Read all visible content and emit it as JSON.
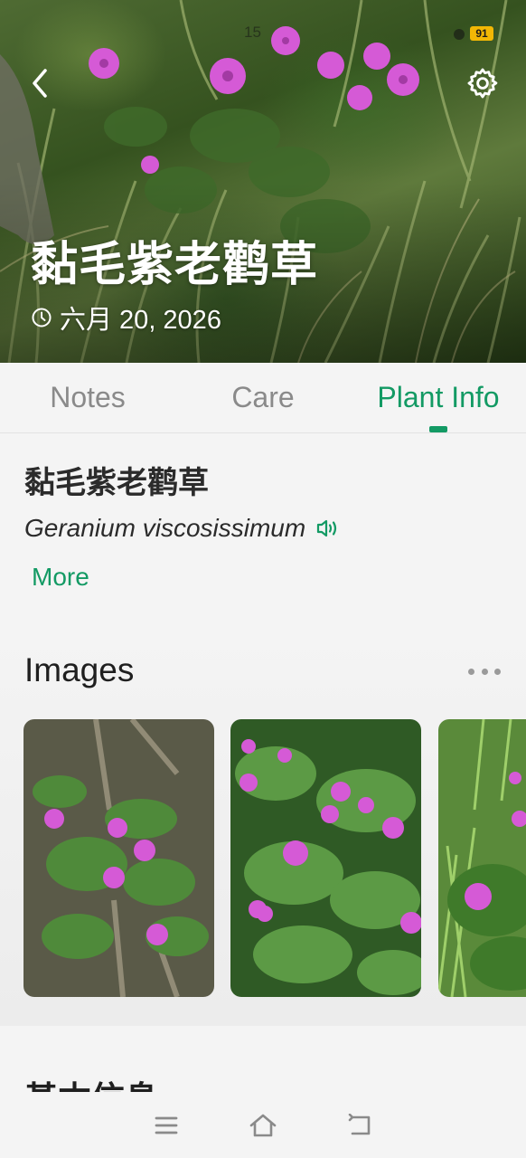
{
  "status_bar": {
    "time": "15",
    "battery": "91"
  },
  "header": {
    "title": "黏毛紫老鹳草",
    "date": "六月 20, 2026",
    "back_icon": "chevron-left-icon",
    "settings_icon": "gear-icon"
  },
  "tabs": [
    {
      "label": "Notes",
      "active": false
    },
    {
      "label": "Care",
      "active": false
    },
    {
      "label": "Plant Info",
      "active": true
    }
  ],
  "plant_info": {
    "common_name": "黏毛紫老鹳草",
    "scientific_name": "Geranium viscosissimum",
    "more_label": "More"
  },
  "images_section": {
    "title": "Images",
    "menu_icon": "more-horizontal-icon",
    "image_count_visible": 3
  },
  "basic_info_section": {
    "title": "基本信息"
  },
  "navbar": {
    "icons": [
      "menu-icon",
      "home-icon",
      "back-icon"
    ]
  },
  "colors": {
    "accent": "#139a64",
    "flower": "#d55ad6",
    "background": "#f4f4f4"
  }
}
